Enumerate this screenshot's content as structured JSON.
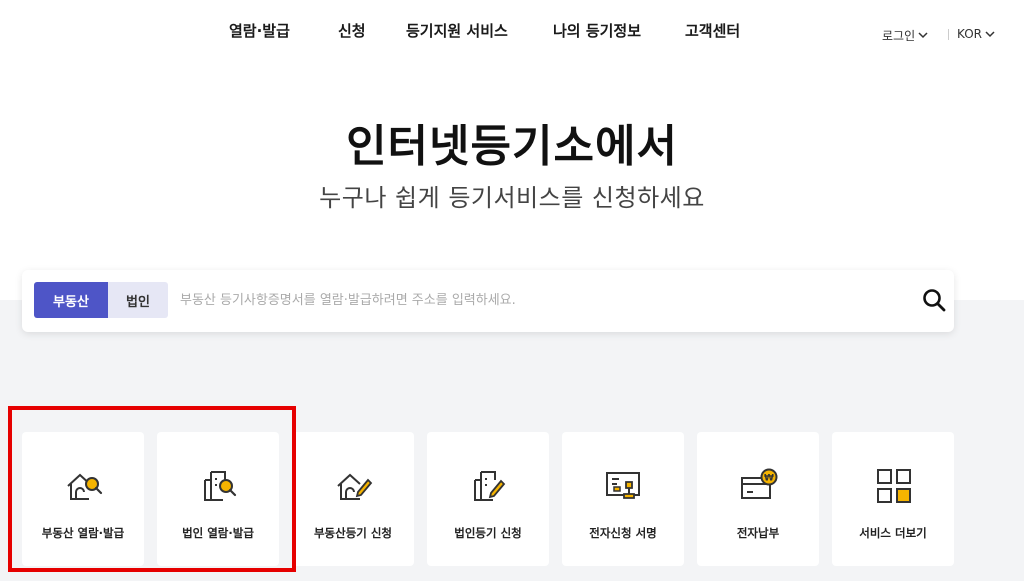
{
  "nav": {
    "items": [
      "열람·발급",
      "신청",
      "등기지원 서비스",
      "나의 등기정보",
      "고객센터"
    ],
    "login": "로그인",
    "lang": "KOR"
  },
  "hero": {
    "title": "인터넷등기소에서",
    "subtitle": "누구나 쉽게 등기서비스를 신청하세요"
  },
  "search": {
    "tabs": [
      "부동산",
      "법인"
    ],
    "active_tab": "부동산",
    "placeholder": "부동산 등기사항증명서를 열람·발급하려면 주소를 입력하세요.",
    "value": ""
  },
  "services": [
    {
      "label": "부동산 열람·발급",
      "icon": "house-search-icon"
    },
    {
      "label": "법인 열람·발급",
      "icon": "building-search-icon"
    },
    {
      "label": "부동산등기 신청",
      "icon": "house-pen-icon"
    },
    {
      "label": "법인등기 신청",
      "icon": "building-pen-icon"
    },
    {
      "label": "전자신청 서명",
      "icon": "certificate-stamp-icon"
    },
    {
      "label": "전자납부",
      "icon": "card-coin-icon"
    },
    {
      "label": "서비스 더보기",
      "icon": "grid-more-icon"
    }
  ],
  "colors": {
    "accent": "#4e55c7",
    "accent_light": "#e6e7f5",
    "icon_yellow": "#f6b400",
    "highlight_red": "#e60000"
  }
}
